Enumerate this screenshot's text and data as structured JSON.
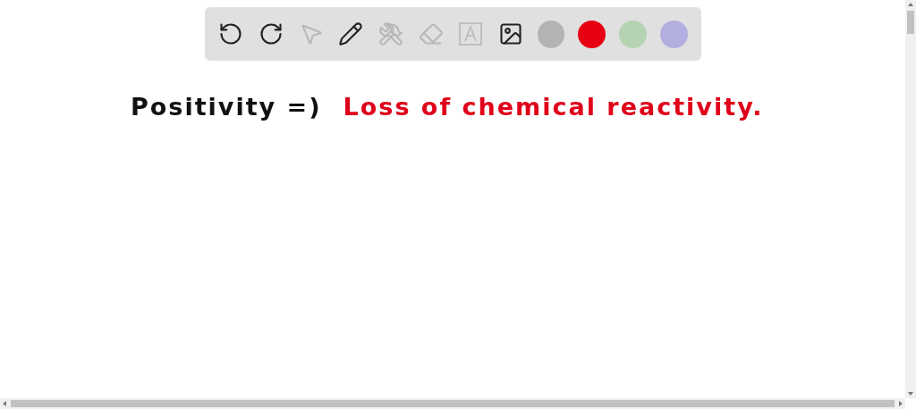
{
  "toolbar": {
    "tools": [
      {
        "kind": "undo",
        "disabled": false
      },
      {
        "kind": "redo",
        "disabled": false
      },
      {
        "kind": "select",
        "disabled": true
      },
      {
        "kind": "pen",
        "disabled": false
      },
      {
        "kind": "tools",
        "disabled": true
      },
      {
        "kind": "eraser",
        "disabled": true
      },
      {
        "kind": "text",
        "disabled": true
      },
      {
        "kind": "image",
        "disabled": false
      }
    ],
    "colors": [
      {
        "color": "#b3b3b3"
      },
      {
        "color": "#e60012"
      },
      {
        "color": "#b5d3b3"
      },
      {
        "color": "#b3aee0"
      }
    ]
  },
  "canvas": {
    "ink": [
      {
        "text": "Positivity =)",
        "color": "#111111"
      },
      {
        "text": "Loss of chemical reactivity.",
        "color": "#e0001a"
      }
    ]
  }
}
